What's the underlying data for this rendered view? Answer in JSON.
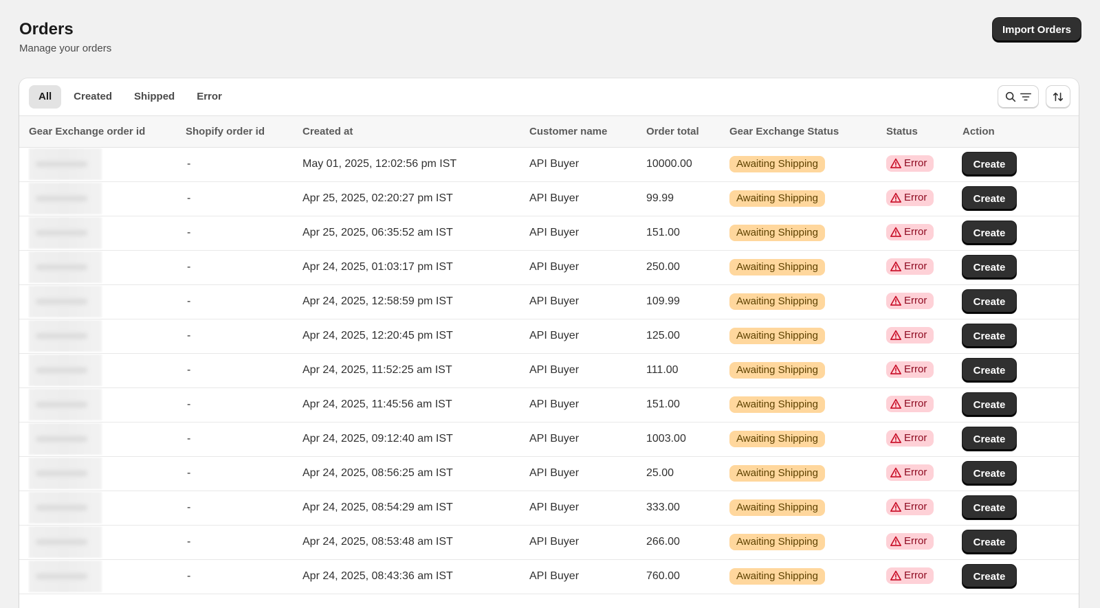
{
  "header": {
    "title": "Orders",
    "subtitle": "Manage your orders",
    "import_label": "Import Orders"
  },
  "tabs": [
    {
      "label": "All",
      "active": true
    },
    {
      "label": "Created",
      "active": false
    },
    {
      "label": "Shipped",
      "active": false
    },
    {
      "label": "Error",
      "active": false
    }
  ],
  "toolbar": {
    "search_filter_icon": "search-filter-icon",
    "sort_icon": "sort-icon"
  },
  "table": {
    "columns": [
      "Gear Exchange order id",
      "Shopify order id",
      "Created at",
      "Customer name",
      "Order total",
      "Gear Exchange Status",
      "Status",
      "Action"
    ],
    "rows": [
      {
        "shopify_id": "-",
        "created_at": "May 01, 2025, 12:02:56 pm IST",
        "customer": "API Buyer",
        "total": "10000.00",
        "ge_status": "Awaiting Shipping",
        "status": "Error",
        "action": "Create"
      },
      {
        "shopify_id": "-",
        "created_at": "Apr 25, 2025, 02:20:27 pm IST",
        "customer": "API Buyer",
        "total": "99.99",
        "ge_status": "Awaiting Shipping",
        "status": "Error",
        "action": "Create"
      },
      {
        "shopify_id": "-",
        "created_at": "Apr 25, 2025, 06:35:52 am IST",
        "customer": "API Buyer",
        "total": "151.00",
        "ge_status": "Awaiting Shipping",
        "status": "Error",
        "action": "Create"
      },
      {
        "shopify_id": "-",
        "created_at": "Apr 24, 2025, 01:03:17 pm IST",
        "customer": "API Buyer",
        "total": "250.00",
        "ge_status": "Awaiting Shipping",
        "status": "Error",
        "action": "Create"
      },
      {
        "shopify_id": "-",
        "created_at": "Apr 24, 2025, 12:58:59 pm IST",
        "customer": "API Buyer",
        "total": "109.99",
        "ge_status": "Awaiting Shipping",
        "status": "Error",
        "action": "Create"
      },
      {
        "shopify_id": "-",
        "created_at": "Apr 24, 2025, 12:20:45 pm IST",
        "customer": "API Buyer",
        "total": "125.00",
        "ge_status": "Awaiting Shipping",
        "status": "Error",
        "action": "Create"
      },
      {
        "shopify_id": "-",
        "created_at": "Apr 24, 2025, 11:52:25 am IST",
        "customer": "API Buyer",
        "total": "111.00",
        "ge_status": "Awaiting Shipping",
        "status": "Error",
        "action": "Create"
      },
      {
        "shopify_id": "-",
        "created_at": "Apr 24, 2025, 11:45:56 am IST",
        "customer": "API Buyer",
        "total": "151.00",
        "ge_status": "Awaiting Shipping",
        "status": "Error",
        "action": "Create"
      },
      {
        "shopify_id": "-",
        "created_at": "Apr 24, 2025, 09:12:40 am IST",
        "customer": "API Buyer",
        "total": "1003.00",
        "ge_status": "Awaiting Shipping",
        "status": "Error",
        "action": "Create"
      },
      {
        "shopify_id": "-",
        "created_at": "Apr 24, 2025, 08:56:25 am IST",
        "customer": "API Buyer",
        "total": "25.00",
        "ge_status": "Awaiting Shipping",
        "status": "Error",
        "action": "Create"
      },
      {
        "shopify_id": "-",
        "created_at": "Apr 24, 2025, 08:54:29 am IST",
        "customer": "API Buyer",
        "total": "333.00",
        "ge_status": "Awaiting Shipping",
        "status": "Error",
        "action": "Create"
      },
      {
        "shopify_id": "-",
        "created_at": "Apr 24, 2025, 08:53:48 am IST",
        "customer": "API Buyer",
        "total": "266.00",
        "ge_status": "Awaiting Shipping",
        "status": "Error",
        "action": "Create"
      },
      {
        "shopify_id": "-",
        "created_at": "Apr 24, 2025, 08:43:36 am IST",
        "customer": "API Buyer",
        "total": "760.00",
        "ge_status": "Awaiting Shipping",
        "status": "Error",
        "action": "Create"
      }
    ]
  },
  "colors": {
    "awaiting_bg": "#ffd79d",
    "error_bg": "#fed1d7",
    "error_text": "#8e0b21",
    "primary_button": "#303030"
  }
}
